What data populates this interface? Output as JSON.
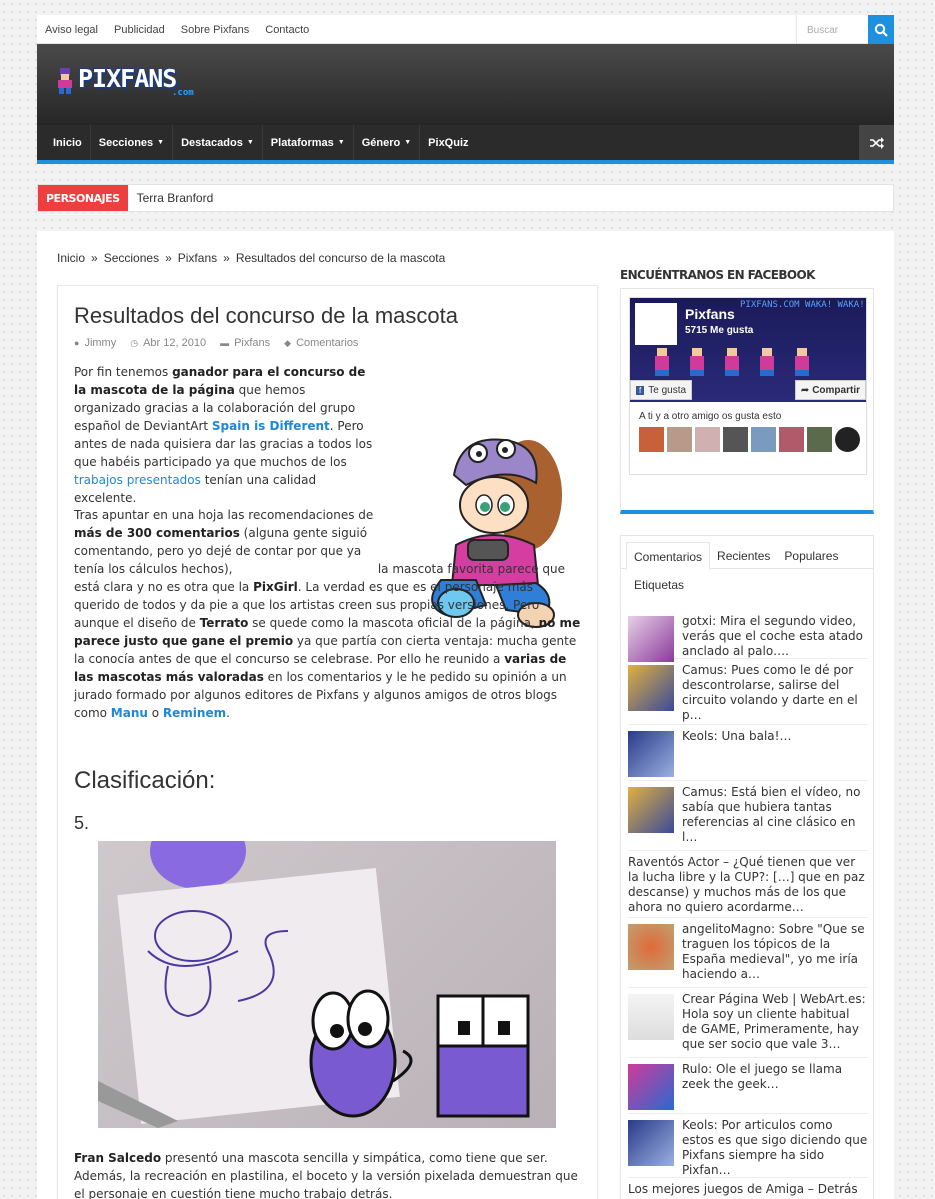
{
  "topbar": {
    "links": [
      "Aviso legal",
      "Publicidad",
      "Sobre Pixfans",
      "Contacto"
    ],
    "search_placeholder": "Buscar"
  },
  "logo": {
    "word": "PIXFANS",
    "dotcom": ".com"
  },
  "mainnav": {
    "items": [
      {
        "label": "Inicio",
        "caret": false
      },
      {
        "label": "Secciones",
        "caret": true
      },
      {
        "label": "Destacados",
        "caret": true
      },
      {
        "label": "Plataformas",
        "caret": true
      },
      {
        "label": "Género",
        "caret": true
      },
      {
        "label": "PixQuiz",
        "caret": false
      }
    ]
  },
  "ticker": {
    "tag": "PERSONAJES",
    "text": "Terra Branford"
  },
  "breadcrumb": [
    "Inicio",
    "Secciones",
    "Pixfans",
    "Resultados del concurso de la mascota"
  ],
  "post": {
    "title": "Resultados del concurso de la mascota",
    "author": "Jimmy",
    "date": "Abr 12, 2010",
    "category": "Pixfans",
    "comments": "Comentarios",
    "h2": "Clasificación:",
    "h3": "5."
  },
  "sidebar": {
    "fb_heading": "ENCUÉNTRANOS EN FACEBOOK",
    "fb_name": "Pixfans",
    "fb_likes": "5715 Me gusta",
    "fb_banner_text": "PIXFANS.COM WAKA! WAKA! WAKA! WAKA!",
    "fb_like_btn": "Te gusta",
    "fb_share_btn": "Compartir",
    "fb_friends": "A ti y a otro amigo os gusta esto",
    "tabs": [
      "Comentarios",
      "Recientes",
      "Populares"
    ],
    "etiquetas": "Etiquetas",
    "comments": [
      {
        "text": "gotxi: Mira el segundo video, verás que el coche esta atado anclado al palo…."
      },
      {
        "text": "Camus: Pues como le dé por descontrolarse, salirse del circuito volando y darte en el p…"
      },
      {
        "text": "Keols: Una bala!…"
      },
      {
        "text": "Camus: Está bien el vídeo, no sabía que hubiera tantas referencias al cine clásico en l…"
      },
      {
        "text": "Raventós Actor – ¿Qué tienen que ver la lucha libre y la CUP?: […] que en paz descanse) y muchos más de los que ahora no quiero acordarme…"
      },
      {
        "text": "angelitoMagno: Sobre \"Que se traguen los tópicos de la España medieval\", yo me iría haciendo a…"
      },
      {
        "text": "Crear Página Web | WebArt.es: Hola soy un cliente habitual de GAME, Primeramente, hay que ser socio que vale 3…"
      },
      {
        "text": "Rulo: Ole el juego se llama zeek the geek…"
      },
      {
        "text": "Keols: Por articulos como estos es que sigo diciendo que Pixfans siempre ha sido Pixfan…"
      },
      {
        "text": "Los mejores juegos de Amiga – Detrás"
      }
    ]
  }
}
